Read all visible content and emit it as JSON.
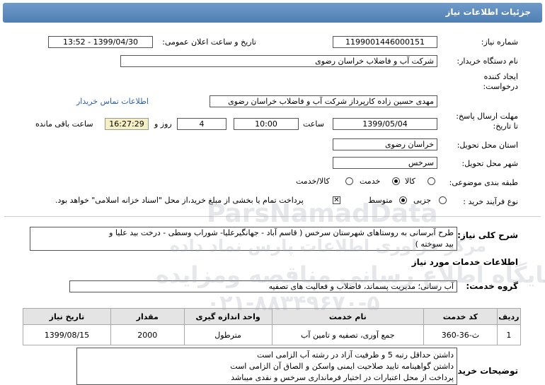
{
  "header": {
    "title": "جزئیات اطلاعات نیاز"
  },
  "fields": {
    "need_number_label": "شماره نیاز:",
    "need_number": "1199001446000151",
    "announce_label": "تاریخ و ساعت اعلان عمومی:",
    "announce_value": "1399/04/30 - 13:52",
    "buyer_label": "نام دستگاه خریدار:",
    "buyer_value": "شرکت آب و فاضلاب خراسان رضوی",
    "creator_label_1": "ایجاد کننده",
    "creator_label_2": "درخواست:",
    "creator_value": "مهدی حسین زاده کارپرداز شرکت آب و فاضلاب خراسان رضوی",
    "contact_link": "اطلاعات تماس خریدار",
    "deadline_label_1": "مهلت ارسال پاسخ:",
    "deadline_label_2": "تا تاریخ:",
    "deadline_date": "1399/05/04",
    "time_label": "ساعت",
    "deadline_time": "10:00",
    "days_value": "4",
    "days_label": "روز و",
    "remaining_time": "16:27:29",
    "remaining_label": "ساعت باقی مانده",
    "province_label": "استان محل تحویل:",
    "province_value": "خراسان رضوی",
    "city_label": "شهر محل تحویل:",
    "city_value": "سرخس",
    "category_label": "طبقه بندی موضوعی:",
    "category_options": [
      "کالا",
      "خدمت",
      "کالا/خدمت"
    ],
    "process_label": "نوع فرآیند خرید :",
    "process_options": [
      "جزیی",
      "متوسط"
    ],
    "payment_note": "پرداخت تمام یا بخشی از مبلغ خرید،از محل \"اسناد خزانه اسلامی\" خواهد بود."
  },
  "description": {
    "label": "شرح کلی نیاز:",
    "text_line1": "طرح آبرسانی به روستاهای شهرستان سرخس ( قاسم آباد - جهانگیرعلیا- شوراب وسطی - درخت بید علیا و",
    "text_line2": "بید سوخته )"
  },
  "services": {
    "section_title": "اطلاعات خدمات مورد نیاز",
    "group_label": "گروه خدمت:",
    "group_value": "آب رسانی؛ مدیریت پسماند، فاضلاب و فعالیت های تصفیه",
    "columns": [
      "ردیف",
      "کد خدمت",
      "نام خدمت",
      "واحد اندازه گیری",
      "مقدار",
      "تاریخ نیاز"
    ],
    "rows": [
      [
        "1",
        "ث-36-360",
        "جمع آوری، تصفیه و تامین آب",
        "مترطول",
        "2000",
        "1399/08/15"
      ]
    ]
  },
  "buyer_notes": {
    "label": "توضیحات خریدار:",
    "lines": [
      "داشتن حداقل رتبه 5 و ظرفیت آزاد در رشته آب الزامی است",
      "داشتن گواهینامه تایید صلاحیت ایمنی واسکن و الصاق آن الزامی است",
      "پرداخت از محل اعتبارات در اختیار فرمانداری سرخس و نقدی میباشد"
    ]
  },
  "watermark": {
    "brand": "ParsNamadData",
    "line1": "مرکز فراوری اطلاعات پارس نماد داده",
    "line2": "پایگاه اطلاع رسانی مناقصه ومزایده",
    "phone": "۰۲۱-۸۸۳۴۹۶۷۰-۵"
  }
}
